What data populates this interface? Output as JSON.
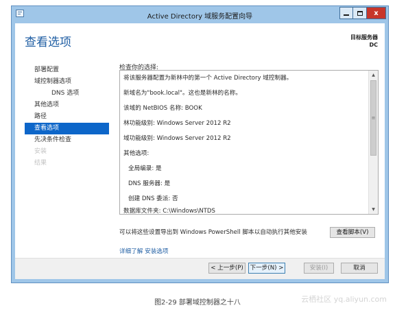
{
  "window": {
    "title": "Active Directory 域服务配置向导",
    "close_label": "x"
  },
  "page": {
    "title": "查看选项",
    "target_server_label": "目标服务器",
    "target_server_value": "DC"
  },
  "nav": {
    "items": [
      {
        "label": "部署配置",
        "state": "normal"
      },
      {
        "label": "域控制器选项",
        "state": "normal"
      },
      {
        "label": "DNS 选项",
        "state": "sub"
      },
      {
        "label": "其他选项",
        "state": "normal"
      },
      {
        "label": "路径",
        "state": "normal"
      },
      {
        "label": "查看选项",
        "state": "selected"
      },
      {
        "label": "先决条件检查",
        "state": "normal"
      },
      {
        "label": "安装",
        "state": "disabled"
      },
      {
        "label": "结果",
        "state": "disabled"
      }
    ]
  },
  "review": {
    "label": "检查你的选择:",
    "lines": [
      "将该服务器配置为新林中的第一个 Active Directory 域控制器。",
      "新域名为\"book.local\"。这也是新林的名称。",
      "该域的 NetBIOS 名称: BOOK",
      "林功能级别: Windows Server 2012 R2",
      "域功能级别: Windows Server 2012 R2",
      "其他选项:",
      "全局编录: 是",
      "DNS 服务器: 是",
      "创建 DNS 委派: 否",
      "数据库文件夹: C:\\Windows\\NTDS"
    ]
  },
  "export": {
    "text": "可以将这些设置导出到 Windows PowerShell 脚本以自动执行其他安装",
    "view_script_label": "查看脚本(V)"
  },
  "more_link": "详细了解 安装选项",
  "footer": {
    "prev_label": "< 上一步(P)",
    "next_label": "下一步(N) >",
    "install_label": "安装(I)",
    "cancel_label": "取消"
  },
  "caption": "图2-29   部署域控制器之十八",
  "watermark": "云栖社区 yq.aliyun.com"
}
